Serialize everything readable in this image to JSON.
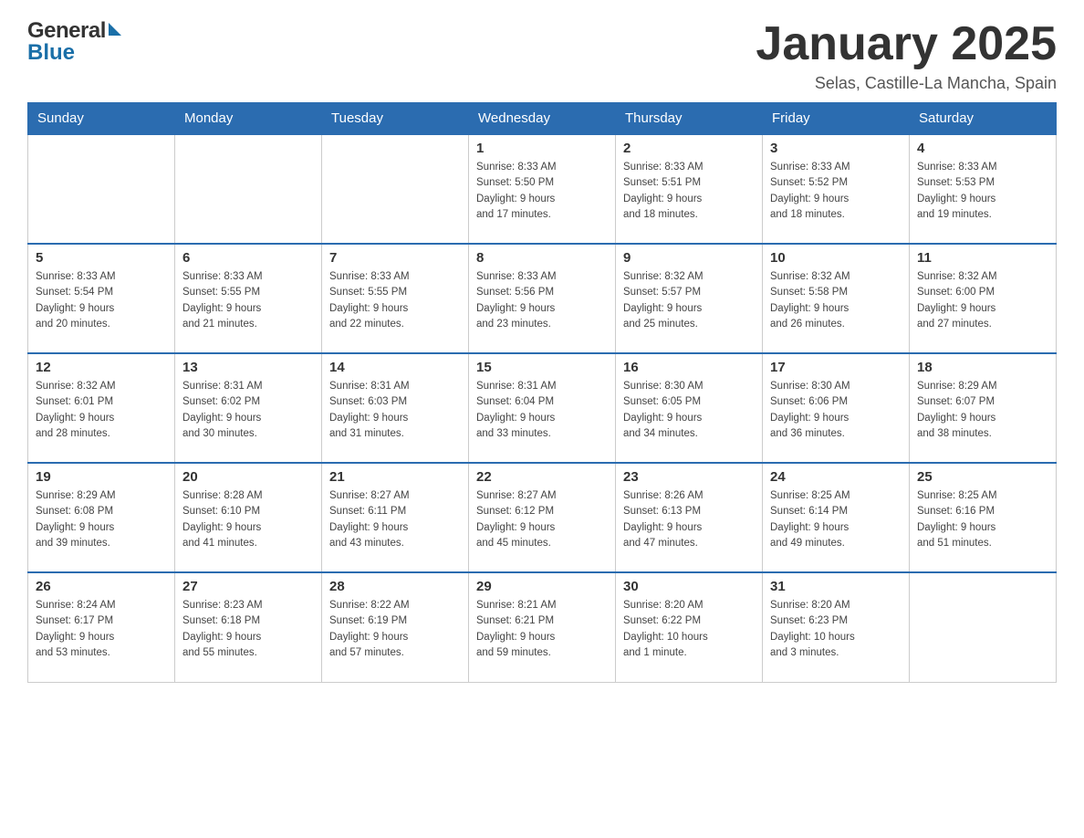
{
  "header": {
    "logo_general": "General",
    "logo_blue": "Blue",
    "month_title": "January 2025",
    "location": "Selas, Castille-La Mancha, Spain"
  },
  "weekdays": [
    "Sunday",
    "Monday",
    "Tuesday",
    "Wednesday",
    "Thursday",
    "Friday",
    "Saturday"
  ],
  "weeks": [
    [
      {
        "day": "",
        "info": ""
      },
      {
        "day": "",
        "info": ""
      },
      {
        "day": "",
        "info": ""
      },
      {
        "day": "1",
        "info": "Sunrise: 8:33 AM\nSunset: 5:50 PM\nDaylight: 9 hours\nand 17 minutes."
      },
      {
        "day": "2",
        "info": "Sunrise: 8:33 AM\nSunset: 5:51 PM\nDaylight: 9 hours\nand 18 minutes."
      },
      {
        "day": "3",
        "info": "Sunrise: 8:33 AM\nSunset: 5:52 PM\nDaylight: 9 hours\nand 18 minutes."
      },
      {
        "day": "4",
        "info": "Sunrise: 8:33 AM\nSunset: 5:53 PM\nDaylight: 9 hours\nand 19 minutes."
      }
    ],
    [
      {
        "day": "5",
        "info": "Sunrise: 8:33 AM\nSunset: 5:54 PM\nDaylight: 9 hours\nand 20 minutes."
      },
      {
        "day": "6",
        "info": "Sunrise: 8:33 AM\nSunset: 5:55 PM\nDaylight: 9 hours\nand 21 minutes."
      },
      {
        "day": "7",
        "info": "Sunrise: 8:33 AM\nSunset: 5:55 PM\nDaylight: 9 hours\nand 22 minutes."
      },
      {
        "day": "8",
        "info": "Sunrise: 8:33 AM\nSunset: 5:56 PM\nDaylight: 9 hours\nand 23 minutes."
      },
      {
        "day": "9",
        "info": "Sunrise: 8:32 AM\nSunset: 5:57 PM\nDaylight: 9 hours\nand 25 minutes."
      },
      {
        "day": "10",
        "info": "Sunrise: 8:32 AM\nSunset: 5:58 PM\nDaylight: 9 hours\nand 26 minutes."
      },
      {
        "day": "11",
        "info": "Sunrise: 8:32 AM\nSunset: 6:00 PM\nDaylight: 9 hours\nand 27 minutes."
      }
    ],
    [
      {
        "day": "12",
        "info": "Sunrise: 8:32 AM\nSunset: 6:01 PM\nDaylight: 9 hours\nand 28 minutes."
      },
      {
        "day": "13",
        "info": "Sunrise: 8:31 AM\nSunset: 6:02 PM\nDaylight: 9 hours\nand 30 minutes."
      },
      {
        "day": "14",
        "info": "Sunrise: 8:31 AM\nSunset: 6:03 PM\nDaylight: 9 hours\nand 31 minutes."
      },
      {
        "day": "15",
        "info": "Sunrise: 8:31 AM\nSunset: 6:04 PM\nDaylight: 9 hours\nand 33 minutes."
      },
      {
        "day": "16",
        "info": "Sunrise: 8:30 AM\nSunset: 6:05 PM\nDaylight: 9 hours\nand 34 minutes."
      },
      {
        "day": "17",
        "info": "Sunrise: 8:30 AM\nSunset: 6:06 PM\nDaylight: 9 hours\nand 36 minutes."
      },
      {
        "day": "18",
        "info": "Sunrise: 8:29 AM\nSunset: 6:07 PM\nDaylight: 9 hours\nand 38 minutes."
      }
    ],
    [
      {
        "day": "19",
        "info": "Sunrise: 8:29 AM\nSunset: 6:08 PM\nDaylight: 9 hours\nand 39 minutes."
      },
      {
        "day": "20",
        "info": "Sunrise: 8:28 AM\nSunset: 6:10 PM\nDaylight: 9 hours\nand 41 minutes."
      },
      {
        "day": "21",
        "info": "Sunrise: 8:27 AM\nSunset: 6:11 PM\nDaylight: 9 hours\nand 43 minutes."
      },
      {
        "day": "22",
        "info": "Sunrise: 8:27 AM\nSunset: 6:12 PM\nDaylight: 9 hours\nand 45 minutes."
      },
      {
        "day": "23",
        "info": "Sunrise: 8:26 AM\nSunset: 6:13 PM\nDaylight: 9 hours\nand 47 minutes."
      },
      {
        "day": "24",
        "info": "Sunrise: 8:25 AM\nSunset: 6:14 PM\nDaylight: 9 hours\nand 49 minutes."
      },
      {
        "day": "25",
        "info": "Sunrise: 8:25 AM\nSunset: 6:16 PM\nDaylight: 9 hours\nand 51 minutes."
      }
    ],
    [
      {
        "day": "26",
        "info": "Sunrise: 8:24 AM\nSunset: 6:17 PM\nDaylight: 9 hours\nand 53 minutes."
      },
      {
        "day": "27",
        "info": "Sunrise: 8:23 AM\nSunset: 6:18 PM\nDaylight: 9 hours\nand 55 minutes."
      },
      {
        "day": "28",
        "info": "Sunrise: 8:22 AM\nSunset: 6:19 PM\nDaylight: 9 hours\nand 57 minutes."
      },
      {
        "day": "29",
        "info": "Sunrise: 8:21 AM\nSunset: 6:21 PM\nDaylight: 9 hours\nand 59 minutes."
      },
      {
        "day": "30",
        "info": "Sunrise: 8:20 AM\nSunset: 6:22 PM\nDaylight: 10 hours\nand 1 minute."
      },
      {
        "day": "31",
        "info": "Sunrise: 8:20 AM\nSunset: 6:23 PM\nDaylight: 10 hours\nand 3 minutes."
      },
      {
        "day": "",
        "info": ""
      }
    ]
  ]
}
